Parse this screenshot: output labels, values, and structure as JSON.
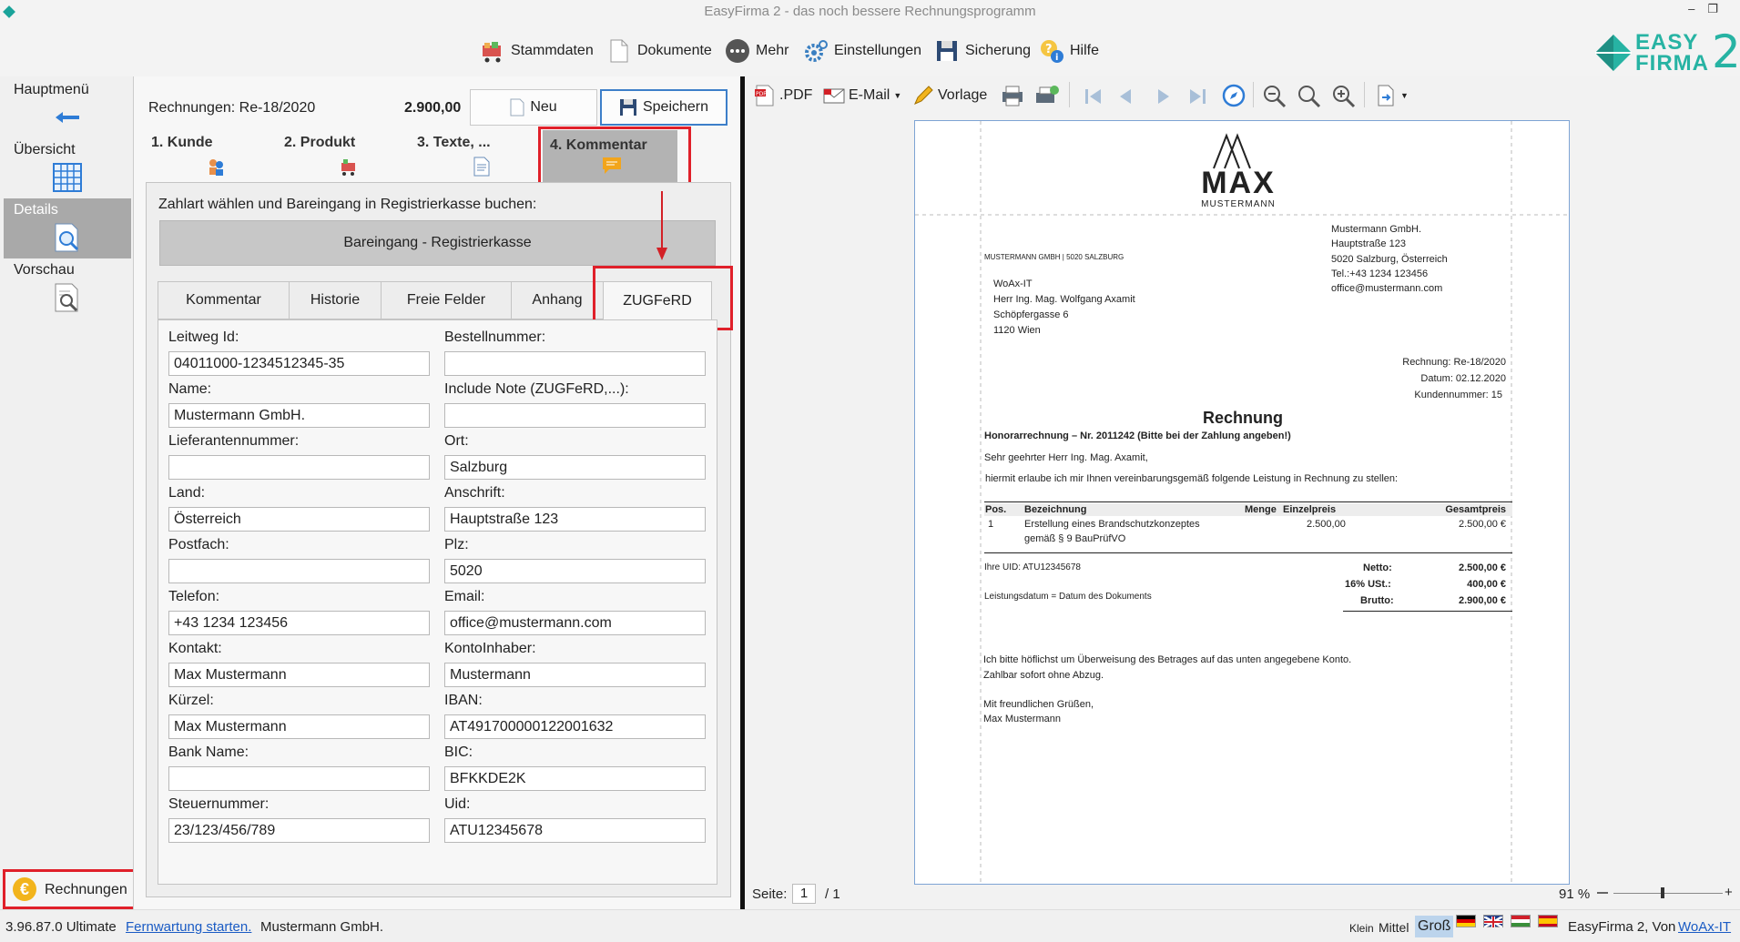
{
  "window": {
    "title": "EasyFirma 2 - das noch bessere Rechnungsprogramm"
  },
  "toolbar": {
    "stammdaten": "Stammdaten",
    "dokumente": "Dokumente",
    "mehr": "Mehr",
    "einstellungen": "Einstellungen",
    "sicherung": "Sicherung",
    "hilfe": "Hilfe"
  },
  "logo": {
    "easy": "EASY",
    "firma": "FIRMA",
    "two": "2"
  },
  "nav": {
    "hauptmenu": "Hauptmenü",
    "uebersicht": "Übersicht",
    "details": "Details",
    "vorschau": "Vorschau",
    "rechnungen": "Rechnungen"
  },
  "invoice_header": {
    "label": "Rechnungen: Re-18/2020",
    "amount": "2.900,00",
    "neu": "Neu",
    "speichern": "Speichern"
  },
  "steps": [
    "1. Kunde",
    "2. Produkt",
    "3. Texte, ...",
    "4. Kommentar"
  ],
  "form": {
    "instruction": "Zahlart wählen und Bareingang in Registrierkasse buchen:",
    "bareingang": "Bareingang - Registrierkasse",
    "tabs": [
      "Kommentar",
      "Historie",
      "Freie Felder",
      "Anhang",
      "ZUGFeRD"
    ],
    "left": [
      {
        "label": "Leitweg Id:",
        "value": "04011000-1234512345-35"
      },
      {
        "label": "Name:",
        "value": "Mustermann GmbH."
      },
      {
        "label": "Lieferantennummer:",
        "value": ""
      },
      {
        "label": "Land:",
        "value": "Österreich"
      },
      {
        "label": "Postfach:",
        "value": ""
      },
      {
        "label": "Telefon:",
        "value": "+43 1234 123456"
      },
      {
        "label": "Kontakt:",
        "value": "Max Mustermann"
      },
      {
        "label": "Kürzel:",
        "value": "Max Mustermann"
      },
      {
        "label": "Bank Name:",
        "value": ""
      },
      {
        "label": "Steuernummer:",
        "value": "23/123/456/789"
      }
    ],
    "right": [
      {
        "label": "Bestellnummer:",
        "value": ""
      },
      {
        "label": "Include Note (ZUGFeRD,...):",
        "value": ""
      },
      {
        "label": "Ort:",
        "value": "Salzburg"
      },
      {
        "label": "Anschrift:",
        "value": "Hauptstraße 123"
      },
      {
        "label": "Plz:",
        "value": "5020"
      },
      {
        "label": "Email:",
        "value": "office@mustermann.com"
      },
      {
        "label": "KontoInhaber:",
        "value": "Mustermann"
      },
      {
        "label": "IBAN:",
        "value": "AT491700000122001632"
      },
      {
        "label": "BIC:",
        "value": "BFKKDE2K"
      },
      {
        "label": "Uid:",
        "value": "ATU12345678"
      }
    ]
  },
  "preview_toolbar": {
    "pdf": ".PDF",
    "email": "E-Mail",
    "vorlage": "Vorlage"
  },
  "doc": {
    "logo_text": "MAX",
    "logo_sub": "MUSTERMANN",
    "sender_line": "MUSTERMANN GMBH | 5020 SALZBURG",
    "company": [
      "Mustermann GmbH.",
      "Hauptstraße 123",
      "5020 Salzburg, Österreich",
      "Tel.:+43 1234 123456",
      "office@mustermann.com"
    ],
    "recipient": [
      "WoAx-IT",
      "Herr Ing. Mag. Wolfgang Axamit",
      "Schöpfergasse 6",
      "1120 Wien"
    ],
    "meta": [
      "Rechnung: Re-18/2020",
      "Datum: 02.12.2020",
      "Kundennummer: 15"
    ],
    "title": "Rechnung",
    "subject": "Honorarrechnung – Nr. 2011242 (Bitte bei der Zahlung angeben!)",
    "greeting": "Sehr geehrter Herr Ing. Mag. Axamit,",
    "intro": "hiermit erlaube ich mir Ihnen vereinbarungsgemäß folgende Leistung in Rechnung zu stellen:",
    "cols": {
      "pos": "Pos.",
      "bez": "Bezeichnung",
      "menge": "Menge",
      "einzel": "Einzelpreis",
      "gesamt": "Gesamtpreis"
    },
    "row": {
      "pos": "1",
      "bez1": "Erstellung eines Brandschutzkonzeptes",
      "bez2": "gemäß § 9 BauPrüfVO",
      "einzel": "2.500,00",
      "gesamt": "2.500,00 €"
    },
    "uid": "Ihre UID: ATU12345678",
    "leistung": "Leistungsdatum = Datum des Dokuments",
    "netto_l": "Netto:",
    "netto_v": "2.500,00 €",
    "ust_l": "16%  USt.:",
    "ust_v": "400,00 €",
    "brutto_l": "Brutto:",
    "brutto_v": "2.900,00 €",
    "closing1": "Ich bitte höflichst um Überweisung des Betrages auf das unten angegebene Konto.",
    "closing2": "Zahlbar sofort ohne Abzug.",
    "regards": "Mit freundlichen Grüßen,",
    "signature": "Max Mustermann"
  },
  "preview_status": {
    "seite": "Seite:",
    "page": "1",
    "of": "/ 1",
    "zoom": "91 %"
  },
  "status": {
    "version": "3.96.87.0 Ultimate",
    "link": "Fernwartung starten.",
    "company": "Mustermann GmbH.",
    "klein": "Klein",
    "mittel": "Mittel",
    "gross": "Groß",
    "app": "EasyFirma 2, Von",
    "woax": "WoAx-IT"
  }
}
